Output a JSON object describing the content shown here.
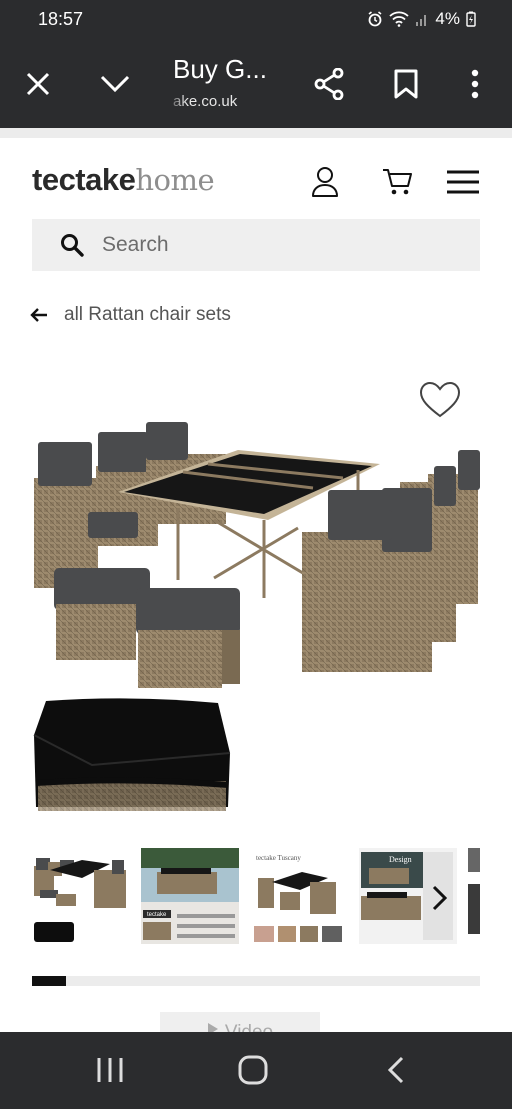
{
  "status_bar": {
    "time": "18:57",
    "battery": "4%",
    "icons": [
      "alarm-icon",
      "wifi-icon",
      "signal-icon",
      "battery-charging-icon"
    ]
  },
  "browser": {
    "title": "Buy G...",
    "url": "ake.co.uk",
    "icons": [
      "close-icon",
      "chevron-down-icon",
      "share-icon",
      "bookmark-icon",
      "more-vert-icon"
    ]
  },
  "header": {
    "logo_bold": "tectake",
    "logo_light": "home",
    "icons": [
      "user-icon",
      "cart-icon",
      "menu-icon"
    ]
  },
  "search": {
    "placeholder": "Search",
    "value": ""
  },
  "breadcrumb": {
    "label": "all Rattan chair sets"
  },
  "gallery": {
    "thumb_count": 5,
    "thumbs": [
      {
        "text": ""
      },
      {
        "text": "tectake"
      },
      {
        "text": "tectake Tuscany"
      },
      {
        "text": "Design"
      },
      {
        "text": ""
      }
    ],
    "progress": 0.076,
    "video_label": "Video"
  },
  "colors": {
    "chrome": "#2b2c2e",
    "rattan": "#8c7a60",
    "cushion": "#4a4b4d",
    "tabletop": "#161616",
    "cover": "#0d0d0d"
  },
  "nav_bar": {
    "icons": [
      "recent-apps-icon",
      "home-icon",
      "back-icon"
    ]
  }
}
